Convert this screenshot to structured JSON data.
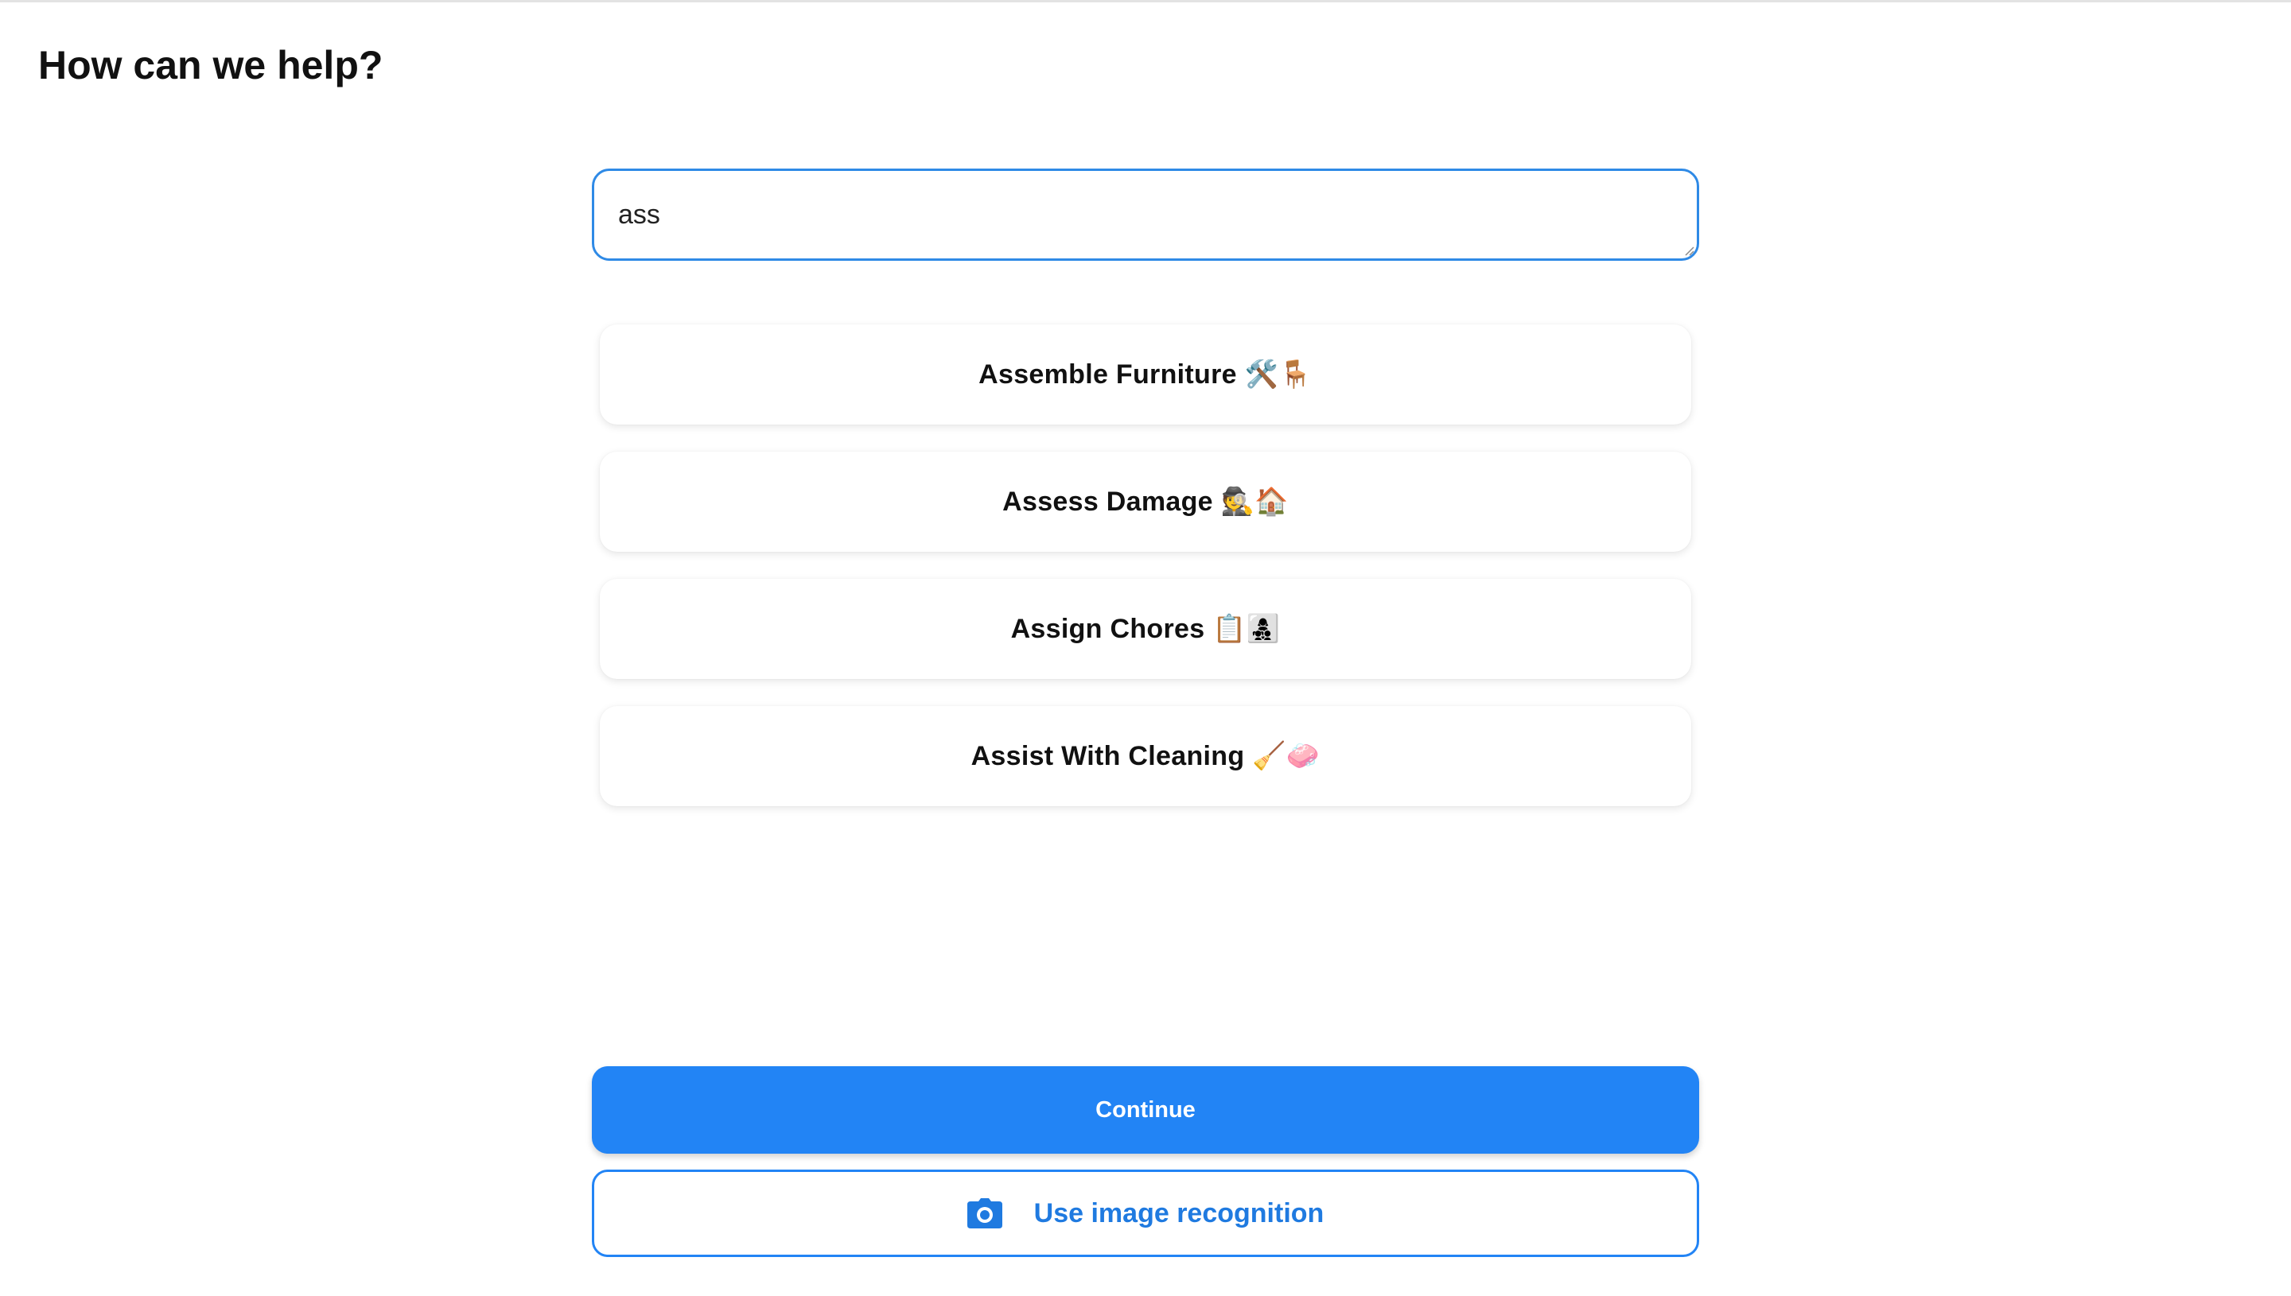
{
  "header": {
    "title": "How can we help?"
  },
  "search": {
    "value": "ass",
    "placeholder": ""
  },
  "suggestions": [
    {
      "label": "Assemble Furniture 🛠️🪑"
    },
    {
      "label": "Assess Damage 🕵️🏠"
    },
    {
      "label": "Assign Chores 📋👩‍👧‍👦"
    },
    {
      "label": "Assist With Cleaning 🧹🧼"
    }
  ],
  "actions": {
    "continue_label": "Continue",
    "image_recognition_label": "Use image recognition",
    "image_recognition_icon": "camera-icon"
  },
  "colors": {
    "accent": "#2284f5",
    "focus_border": "#2f8ae6"
  }
}
